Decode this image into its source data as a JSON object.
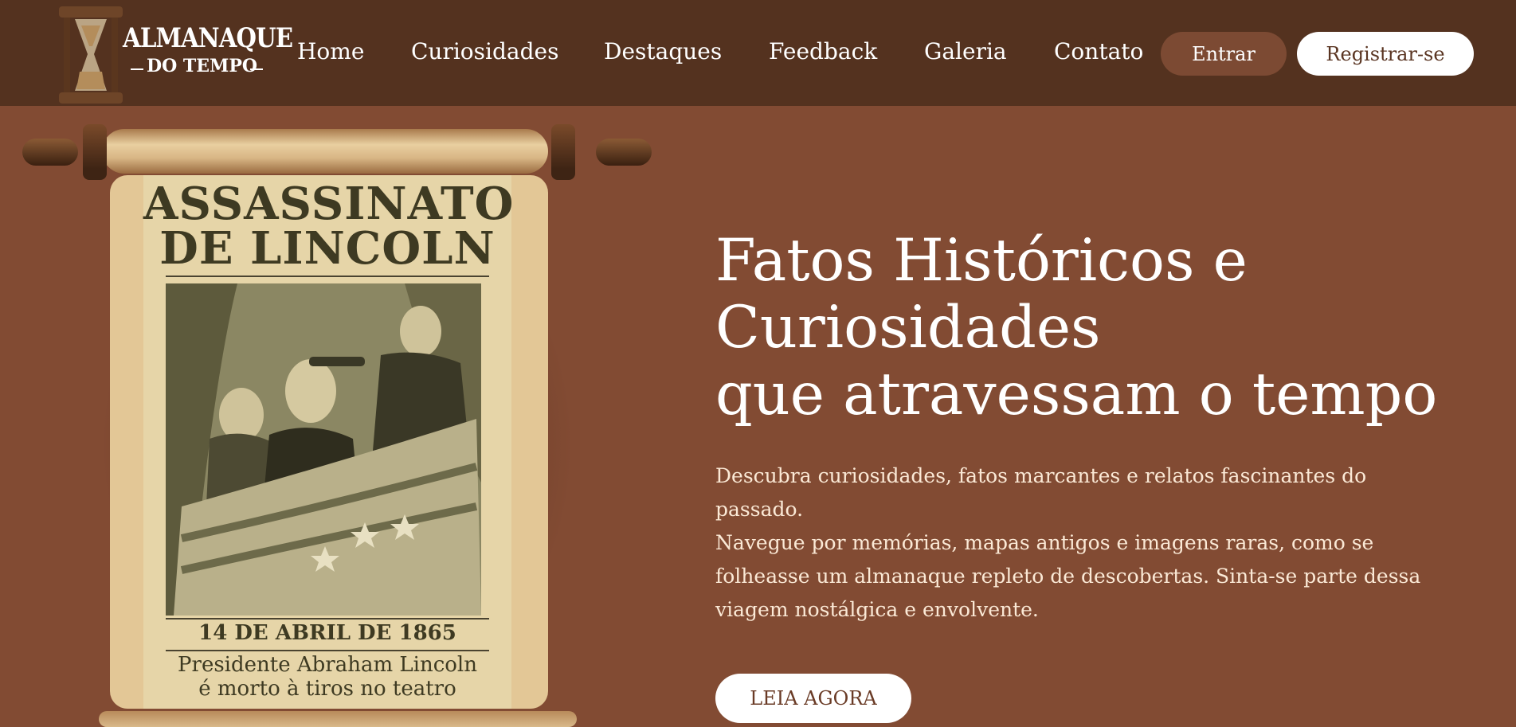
{
  "brand": {
    "logo_line1": "ALMANAQUE",
    "logo_line2": "DO TEMPO",
    "icon": "hourglass-icon"
  },
  "nav": {
    "items": [
      {
        "label": "Home"
      },
      {
        "label": "Curiosidades"
      },
      {
        "label": "Destaques"
      },
      {
        "label": "Feedback"
      },
      {
        "label": "Galeria"
      },
      {
        "label": "Contato"
      }
    ],
    "login_label": "Entrar",
    "register_label": "Registrar-se"
  },
  "poster": {
    "title_line1": "ASSASSINATO",
    "title_line2": "DE LINCOLN",
    "date": "14 DE ABRIL DE 1865",
    "caption_line1": "Presidente Abraham Lincoln",
    "caption_line2": "é morto à tiros no teatro"
  },
  "hero": {
    "title_line1": "Fatos Históricos e",
    "title_line2": "Curiosidades",
    "title_line3": "que atravessam o tempo",
    "paragraph1": "Descubra curiosidades, fatos marcantes e relatos fascinantes do passado.",
    "paragraph2": "Navegue por memórias, mapas antigos e imagens raras, como se folheasse um almanaque repleto de descobertas. Sinta-se parte dessa viagem nostálgica e envolvente.",
    "cta_label": "LEIA AGORA"
  },
  "colors": {
    "header_bg": "#54321f",
    "page_bg": "#824b33",
    "login_button_bg": "#7c4a33",
    "register_button_bg": "#ffffff"
  }
}
